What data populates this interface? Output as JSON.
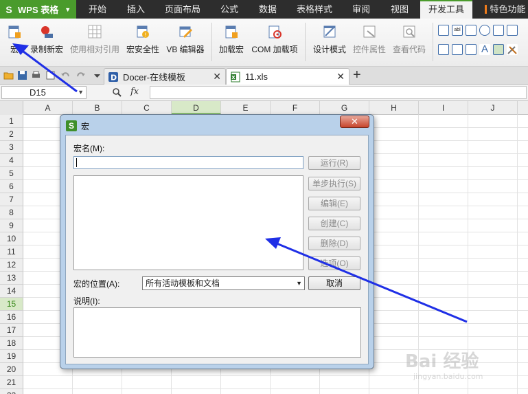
{
  "app": {
    "name": "WPS 表格",
    "logo_letter": "S"
  },
  "menu": {
    "tabs": [
      "开始",
      "插入",
      "页面布局",
      "公式",
      "数据",
      "表格样式",
      "审阅",
      "视图",
      "开发工具",
      "特色功能"
    ],
    "active": "开发工具"
  },
  "ribbon": {
    "macro": "宏",
    "record_macro": "录制新宏",
    "relative_ref": "使用相对引用",
    "macro_security": "宏安全性",
    "vb_editor": "VB 编辑器",
    "load_macro": "加载宏",
    "com_addins": "COM 加载项",
    "design_mode": "设计模式",
    "control_props": "控件属性",
    "view_code": "查看代码"
  },
  "tabs": {
    "docer": "Docer-在线模板",
    "file": "11.xls",
    "add": "+"
  },
  "formula_bar": {
    "name_box": "D15",
    "fx": "fx",
    "value": ""
  },
  "grid": {
    "columns": [
      "A",
      "B",
      "C",
      "D",
      "E",
      "F",
      "G",
      "H",
      "I",
      "J"
    ],
    "rows": [
      "1",
      "2",
      "3",
      "4",
      "5",
      "6",
      "7",
      "8",
      "9",
      "10",
      "11",
      "12",
      "13",
      "14",
      "15",
      "16",
      "17",
      "18",
      "19",
      "20",
      "21",
      "22"
    ],
    "selected_column": "D",
    "selected_row": "15"
  },
  "dialog": {
    "title": "宏",
    "close": "✕",
    "macro_name_label": "宏名(M):",
    "macro_name_value": "",
    "buttons": {
      "run": "运行(R)",
      "step": "单步执行(S)",
      "edit": "编辑(E)",
      "create": "创建(C)",
      "delete": "删除(D)",
      "options": "选项(O)",
      "cancel": "取消"
    },
    "location_label": "宏的位置(A):",
    "location_value": "所有活动模板和文档",
    "description_label": "说明(I):",
    "description_value": ""
  },
  "watermark": {
    "big": "Bai 经验",
    "small": "jingyan.baidu.com"
  },
  "colors": {
    "accent": "#4a9b2c",
    "arrow": "#1f2fe6",
    "dialog_frame": "#b9d1ea"
  }
}
